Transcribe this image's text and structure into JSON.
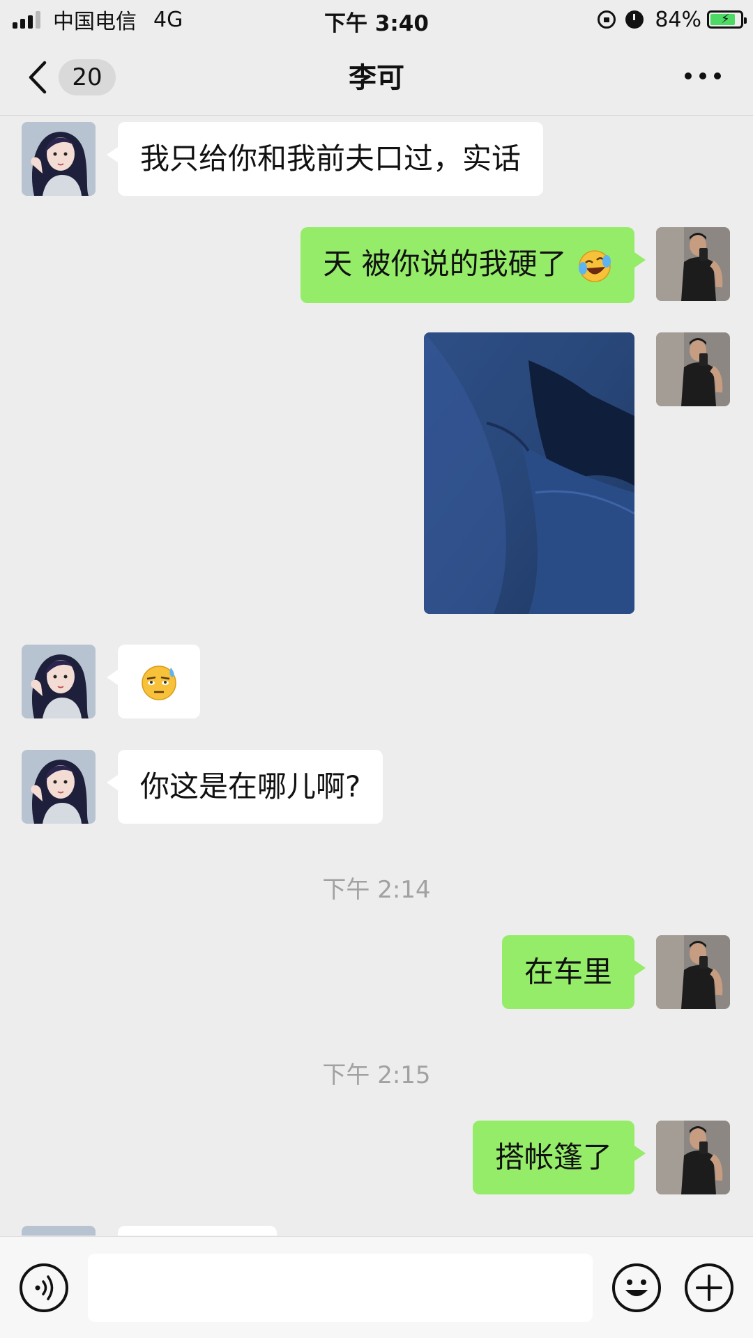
{
  "status_bar": {
    "carrier": "中国电信",
    "network": "4G",
    "time": "下午 3:40",
    "battery_percent": "84%",
    "battery_level": 0.84,
    "icons": [
      "signal-icon",
      "rotation-lock-icon",
      "alarm-icon",
      "battery-charging-icon"
    ]
  },
  "nav": {
    "unread_count": "20",
    "title": "李可",
    "icons": [
      "back-chevron-icon",
      "more-icon"
    ]
  },
  "messages": [
    {
      "side": "left",
      "type": "text",
      "text": "我只给你和我前夫口过，实话"
    },
    {
      "side": "right",
      "type": "text",
      "text": "天 被你说的我硬了",
      "emoji": "crying-laughing-emoji"
    },
    {
      "side": "right",
      "type": "image",
      "image": "dark-blue-fabric-photo"
    },
    {
      "side": "left",
      "type": "emoji",
      "emoji": "sweat-eyeroll-emoji"
    },
    {
      "side": "left",
      "type": "text",
      "text": "你这是在哪儿啊?"
    },
    {
      "type": "timestamp",
      "text": "下午 2:14"
    },
    {
      "side": "right",
      "type": "text",
      "text": "在车里"
    },
    {
      "type": "timestamp",
      "text": "下午 2:15"
    },
    {
      "side": "right",
      "type": "text",
      "text": "搭帐篷了"
    }
  ],
  "input_bar": {
    "icons": [
      "voice-icon",
      "emoji-icon",
      "plus-icon"
    ]
  },
  "colors": {
    "background": "#ededed",
    "sent_bubble": "#95ec69",
    "received_bubble": "#ffffff",
    "timestamp_text": "#a1a1a1"
  }
}
